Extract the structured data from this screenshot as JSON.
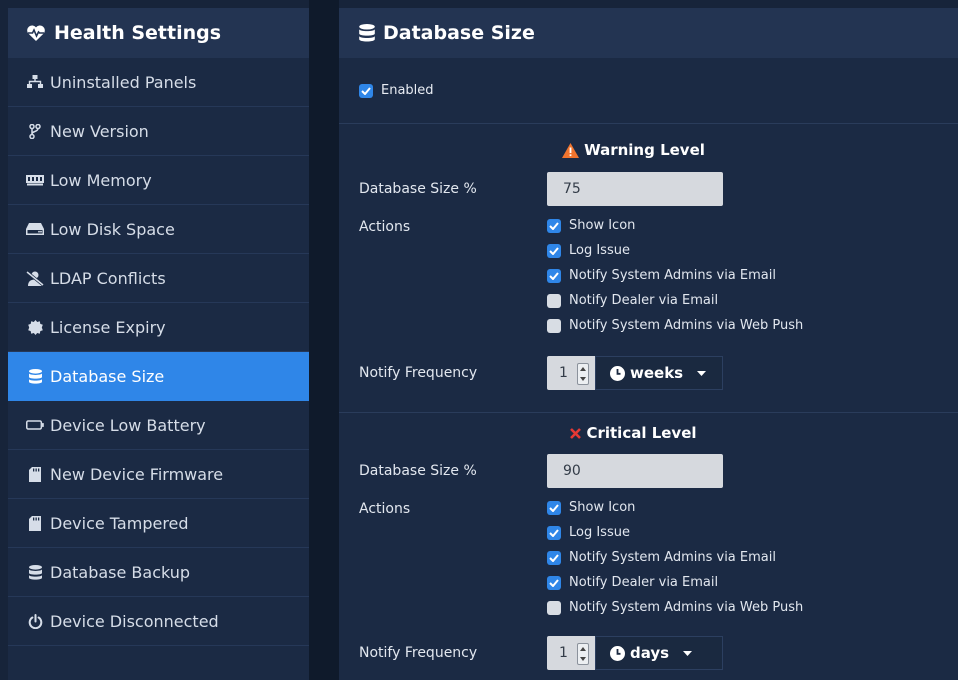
{
  "sidebar": {
    "title": "Health Settings",
    "title_icon": "heart-pulse-icon",
    "items": [
      {
        "label": "Uninstalled Panels",
        "icon": "sitemap-icon",
        "active": false
      },
      {
        "label": "New Version",
        "icon": "code-branch-icon",
        "active": false
      },
      {
        "label": "Low Memory",
        "icon": "memory-icon",
        "active": false
      },
      {
        "label": "Low Disk Space",
        "icon": "hard-drive-icon",
        "active": false
      },
      {
        "label": "LDAP Conflicts",
        "icon": "user-slash-icon",
        "active": false
      },
      {
        "label": "License Expiry",
        "icon": "certificate-icon",
        "active": false
      },
      {
        "label": "Database Size",
        "icon": "database-icon",
        "active": true
      },
      {
        "label": "Device Low Battery",
        "icon": "battery-empty-icon",
        "active": false
      },
      {
        "label": "New Device Firmware",
        "icon": "sd-card-icon",
        "active": false
      },
      {
        "label": "Device Tampered",
        "icon": "sd-card-icon",
        "active": false
      },
      {
        "label": "Database Backup",
        "icon": "database-icon",
        "active": false
      },
      {
        "label": "Device Disconnected",
        "icon": "power-icon",
        "active": false
      }
    ]
  },
  "main": {
    "title": "Database Size",
    "title_icon": "database-icon",
    "enabled": {
      "label": "Enabled",
      "checked": true
    },
    "warning": {
      "title": "Warning Level",
      "icon": "warning-triangle-icon",
      "size_label": "Database Size %",
      "size_value": "75",
      "actions_label": "Actions",
      "actions": [
        {
          "label": "Show Icon",
          "checked": true
        },
        {
          "label": "Log Issue",
          "checked": true
        },
        {
          "label": "Notify System Admins via Email",
          "checked": true
        },
        {
          "label": "Notify Dealer via Email",
          "checked": false
        },
        {
          "label": "Notify System Admins via Web Push",
          "checked": false
        }
      ],
      "frequency_label": "Notify Frequency",
      "frequency_value": "1",
      "frequency_unit": "weeks"
    },
    "critical": {
      "title": "Critical Level",
      "icon": "close-x-icon",
      "size_label": "Database Size %",
      "size_value": "90",
      "actions_label": "Actions",
      "actions": [
        {
          "label": "Show Icon",
          "checked": true
        },
        {
          "label": "Log Issue",
          "checked": true
        },
        {
          "label": "Notify System Admins via Email",
          "checked": true
        },
        {
          "label": "Notify Dealer via Email",
          "checked": true
        },
        {
          "label": "Notify System Admins via Web Push",
          "checked": false
        }
      ],
      "frequency_label": "Notify Frequency",
      "frequency_value": "1",
      "frequency_unit": "days"
    }
  },
  "colors": {
    "accent": "#2f86e8",
    "panel": "#1b2a44",
    "header": "#233452",
    "warning": "#f0742e",
    "critical": "#e53935"
  }
}
